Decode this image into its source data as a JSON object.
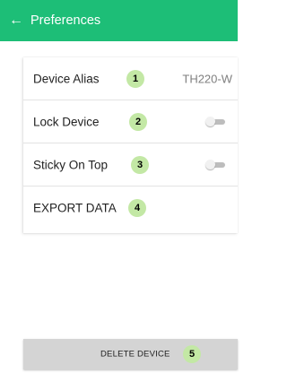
{
  "app_bar": {
    "back_icon": "arrow-left-icon",
    "back_glyph": "←",
    "title": "Preferences",
    "background_color": "#1dbe77"
  },
  "settings": [
    {
      "label": "Device Alias",
      "badge": "1",
      "value": "TH220-W",
      "control": "text"
    },
    {
      "label": "Lock Device",
      "badge": "2",
      "control": "toggle",
      "on": false
    },
    {
      "label": "Sticky On Top",
      "badge": "3",
      "control": "toggle",
      "on": false
    },
    {
      "label": "EXPORT DATA",
      "badge": "4",
      "control": "none"
    }
  ],
  "delete_button": {
    "label": "DELETE DEVICE",
    "badge": "5"
  },
  "badge_color": "#c3e8a5"
}
